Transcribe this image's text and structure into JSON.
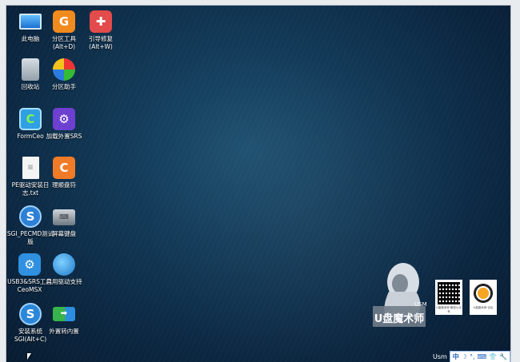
{
  "desktop": {
    "icons": [
      {
        "label": "此电脑",
        "glyph": ""
      },
      {
        "label": "分区工具\n(Alt+D)",
        "glyph": "G"
      },
      {
        "label": "引导修复\n(Alt+W)",
        "glyph": "✚"
      },
      {
        "label": "回收站",
        "glyph": ""
      },
      {
        "label": "分区助手",
        "glyph": ""
      },
      {
        "label": "FormCeo",
        "glyph": "C"
      },
      {
        "label": "加载外置SRS",
        "glyph": "⚙"
      },
      {
        "label": "PE驱动安装日志.txt",
        "glyph": "≡"
      },
      {
        "label": "理顺盘符",
        "glyph": "C"
      },
      {
        "label": "SGI_PECMD测试版",
        "glyph": "S"
      },
      {
        "label": "屏幕键盘",
        "glyph": "⌨"
      },
      {
        "label": "USB3&SRS工具CeoMSX",
        "glyph": "⚙"
      },
      {
        "label": "启用驱动支持",
        "glyph": "🌐"
      },
      {
        "label": "安装系统SGI(Alt+C)",
        "glyph": "S"
      },
      {
        "label": "外置转内置",
        "glyph": "➡"
      }
    ]
  },
  "branding": {
    "logo_text": "U盘魔术师",
    "logo_sub": "USM",
    "qr1_caption": "U盘魔术师·微信公众号",
    "qr2_caption": "U盘魔术师·论坛"
  },
  "taskbar": {
    "label": "Usm",
    "ime_items": [
      "中",
      "☽",
      "°,",
      "⌨",
      "👕",
      "🔧"
    ]
  }
}
